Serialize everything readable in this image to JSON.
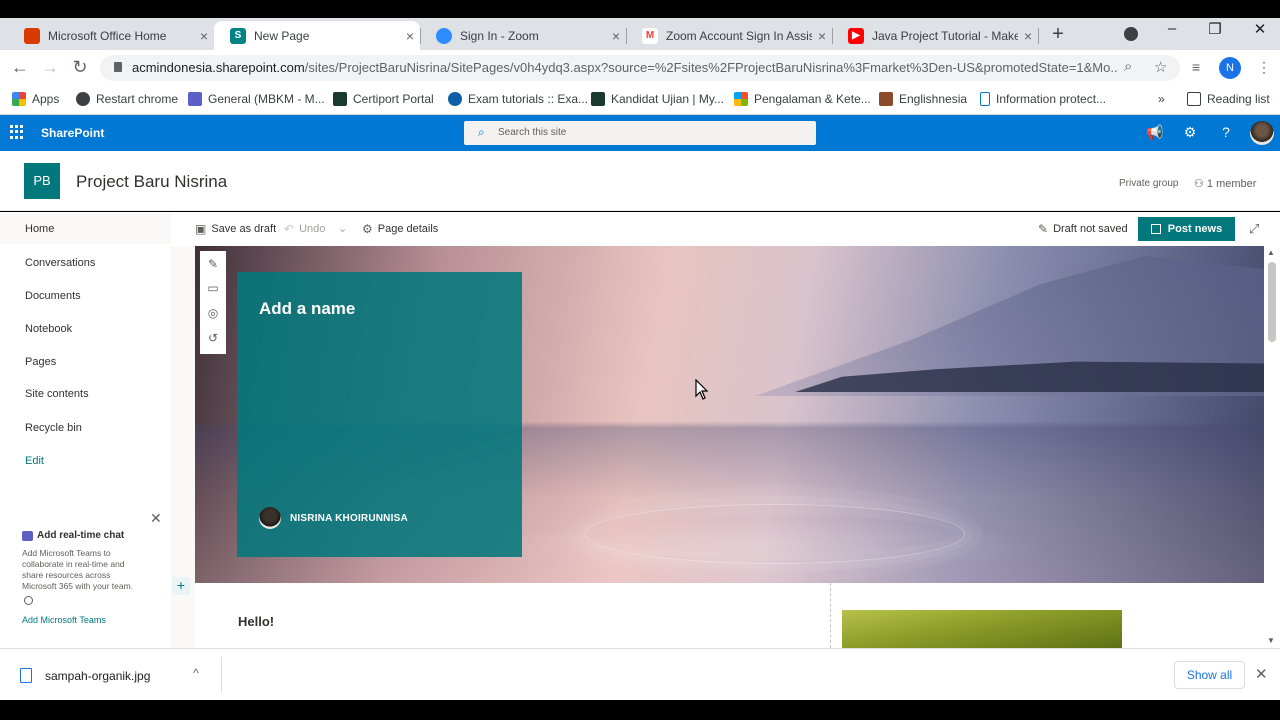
{
  "browser": {
    "tabs": [
      {
        "title": "Microsoft Office Home",
        "icon": "office-icon",
        "color": "#d83b01"
      },
      {
        "title": "New Page",
        "icon": "sharepoint-icon",
        "color": "#038387"
      },
      {
        "title": "Sign In - Zoom",
        "icon": "zoom-icon",
        "color": "#2d8cff"
      },
      {
        "title": "Zoom Account Sign In Assist",
        "icon": "gmail-icon",
        "color": "#ea4335"
      },
      {
        "title": "Java Project Tutorial - Make",
        "icon": "youtube-icon",
        "color": "#ff0000"
      }
    ],
    "url_host": "acmindonesia.sharepoint.com",
    "url_path": "/sites/ProjectBaruNisrina/SitePages/v0h4ydq3.aspx?source=%2Fsites%2FProjectBaruNisrina%3Fmarket%3Den-US&promotedState=1&Mo...",
    "profile_initial": "N",
    "bookmarks": [
      {
        "label": "Apps"
      },
      {
        "label": "Restart chrome"
      },
      {
        "label": "General (MBKM - M..."
      },
      {
        "label": "Certiport Portal"
      },
      {
        "label": "Exam tutorials :: Exa..."
      },
      {
        "label": "Kandidat Ujian | My..."
      },
      {
        "label": "Pengalaman & Kete..."
      },
      {
        "label": "Englishnesia"
      },
      {
        "label": "Information protect..."
      }
    ],
    "more_bookmarks": "»",
    "reading_list": "Reading list"
  },
  "sharepoint": {
    "brand": "SharePoint",
    "search_placeholder": "Search this site",
    "site": {
      "logo_initials": "PB",
      "title": "Project Baru Nisrina",
      "privacy": "Private group",
      "members": "1 member"
    },
    "nav": [
      {
        "label": "Home"
      },
      {
        "label": "Conversations"
      },
      {
        "label": "Documents"
      },
      {
        "label": "Notebook"
      },
      {
        "label": "Pages"
      },
      {
        "label": "Site contents"
      },
      {
        "label": "Recycle bin"
      },
      {
        "label": "Edit"
      }
    ],
    "teams_promo": {
      "title": "Add real-time chat",
      "description": "Add Microsoft Teams to collaborate in real-time and share resources across Microsoft 365 with your team.",
      "link": "Add Microsoft Teams"
    },
    "commands": {
      "save_draft": "Save as draft",
      "undo": "Undo",
      "page_details": "Page details",
      "draft_status": "Draft not saved",
      "post_news": "Post news"
    },
    "hero": {
      "title_placeholder": "Add a name",
      "author": "NISRINA KHOIRUNNISA"
    },
    "section": {
      "heading": "Hello!"
    }
  },
  "downloads": {
    "file": "sampah-organik.jpg",
    "show_all": "Show all"
  },
  "colors": {
    "suite_blue": "#0078d4",
    "site_teal": "#03787c"
  }
}
